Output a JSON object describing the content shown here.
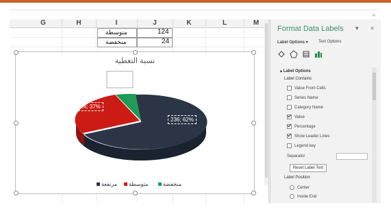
{
  "window": {
    "close_glyph": "×"
  },
  "sheet": {
    "columns": [
      "G",
      "H",
      "I",
      "J",
      "K",
      "L",
      "M"
    ],
    "rows": [
      {
        "label": "متوسطة",
        "value": "124"
      },
      {
        "label": "منخفضة",
        "value": "24"
      }
    ]
  },
  "chart": {
    "title": "نسبة التغطية",
    "labels": {
      "red": "124; 37%",
      "dark": "236; 62%"
    },
    "legend": [
      {
        "name": "مرتفعة",
        "color": "#2b3546"
      },
      {
        "name": "متوسطة",
        "color": "#cc1b14"
      },
      {
        "name": "منخفضة",
        "color": "#1f9b57"
      }
    ]
  },
  "pane": {
    "title": "Format Data Labels",
    "tabs": {
      "label_options": "Label Options",
      "text_options": "Text Options"
    },
    "icons": [
      "fill-icon",
      "pentagon-icon",
      "size-properties-icon",
      "bar-chart-icon"
    ],
    "section": "Label Options",
    "label_contains": "Label Contains",
    "options": [
      {
        "label": "Value From Cells",
        "checked": false
      },
      {
        "label": "Series Name",
        "checked": false
      },
      {
        "label": "Category Name",
        "checked": false
      },
      {
        "label": "Value",
        "checked": true
      },
      {
        "label": "Percentage",
        "checked": true
      },
      {
        "label": "Show Leader Lines",
        "checked": true
      },
      {
        "label": "Legend key",
        "checked": false
      }
    ],
    "separator_label": "Separator",
    "reset_label": "Reset Label Text",
    "label_position": "Label Position",
    "positions": [
      "Center",
      "Inside End"
    ]
  }
}
